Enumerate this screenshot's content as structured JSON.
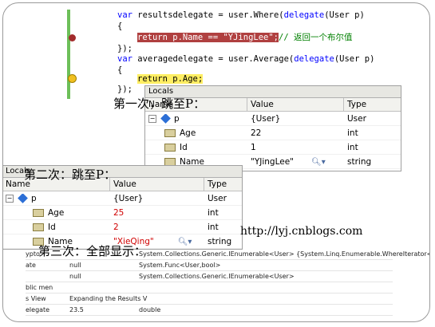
{
  "code": {
    "line1": "var resultsdelegate = user.Where(delegate(User p)",
    "line1_kw1": "var",
    "line1_rest": " resultsdelegate = user.Where(",
    "line1_kw2": "delegate",
    "line1_tail": "(User p)",
    "line2": "{",
    "line3_code": "return p.Name == \"YJingLee\";",
    "line3_comment": "// 返回一个布尔值",
    "line4": "});",
    "line5_kw1": "var",
    "line5_rest": " averagedelegate = user.Average(",
    "line5_kw2": "delegate",
    "line5_tail": "(User p)",
    "line6": "{",
    "line7_code": "return p.Age;",
    "line8": "});"
  },
  "captions": {
    "first": "第一次，跳至P：",
    "second": "第二次：跳至P：",
    "third": "第三次：全部显示：",
    "url": "http://lyj.cnblogs.com"
  },
  "locals1": {
    "title": "Locals",
    "headers": [
      "Name",
      "Value",
      "Type"
    ],
    "rows": [
      {
        "name": "p",
        "value": "{User}",
        "type": "User"
      },
      {
        "name": "Age",
        "value": "22",
        "type": "int"
      },
      {
        "name": "Id",
        "value": "1",
        "type": "int"
      },
      {
        "name": "Name",
        "value": "\"YJingLee\"",
        "type": "string"
      }
    ]
  },
  "locals2": {
    "title": "Locals",
    "headers": [
      "Name",
      "Value",
      "Type"
    ],
    "rows": [
      {
        "name": "p",
        "value": "{User}",
        "type": "User"
      },
      {
        "name": "Age",
        "value": "25",
        "type": "int"
      },
      {
        "name": "Id",
        "value": "2",
        "type": "int"
      },
      {
        "name": "Name",
        "value": "\"XieQing\"",
        "type": "string"
      }
    ]
  },
  "bottom": {
    "rows": [
      {
        "c1": "ypto",
        "c2": "",
        "c3": "System.Collections.Generic.IEnumerable<User> {System.Linq.Enumerable.WhereIterator<"
      },
      {
        "c1": "ate",
        "c2": "null",
        "c3": "System.Func<User,bool>"
      },
      {
        "c1": "",
        "c2": "null",
        "c3": "System.Collections.Generic.IEnumerable<User>"
      },
      {
        "c1": "blic men",
        "c2": "",
        "c3": ""
      },
      {
        "c1": "s View",
        "c2": "Expanding the Results V",
        "c3": ""
      },
      {
        "c1": "elegate",
        "c2": "23.5",
        "c3": "double"
      }
    ]
  },
  "colors": {
    "breakpoint": "#a22c2c",
    "current_line": "#ffee62",
    "keyword": "#0000ff",
    "comment": "#008000",
    "changed_value": "#d00000"
  }
}
